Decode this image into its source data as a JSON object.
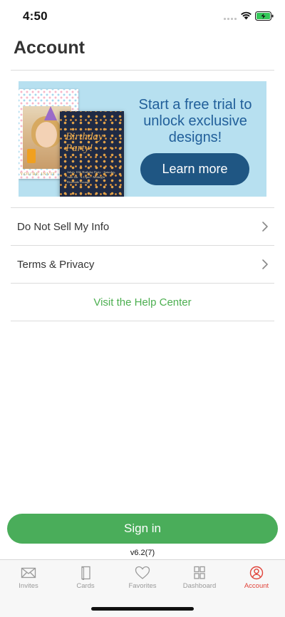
{
  "status_bar": {
    "time": "4:50"
  },
  "header": {
    "title": "Account"
  },
  "promo": {
    "headline": "Start a free trial to unlock exclusive designs!",
    "cta_label": "Learn more",
    "photo_card_caption": "YOU'RE INVIT",
    "invite_card_title": "Birthday Party!",
    "invite_card_details": "Julia's 10th Birthday Party · Saturday, June 4th · 6:15pm - Midnight · Riverside Lounge"
  },
  "list": {
    "items": [
      {
        "label": "Do Not Sell My Info"
      },
      {
        "label": "Terms & Privacy"
      }
    ],
    "help_link": "Visit the Help Center"
  },
  "signin": {
    "label": "Sign in"
  },
  "version": "v6.2(7)",
  "tab_bar": {
    "tabs": [
      {
        "label": "Invites",
        "icon": "envelope-icon"
      },
      {
        "label": "Cards",
        "icon": "card-icon"
      },
      {
        "label": "Favorites",
        "icon": "heart-icon"
      },
      {
        "label": "Dashboard",
        "icon": "grid-icon"
      },
      {
        "label": "Account",
        "icon": "user-icon",
        "active": true
      }
    ]
  },
  "colors": {
    "accent_green": "#4aad5a",
    "promo_background": "#b7e0f0",
    "promo_button": "#1f5683",
    "active_tab": "#e0433a",
    "inactive_tab": "#9a9a9a"
  }
}
